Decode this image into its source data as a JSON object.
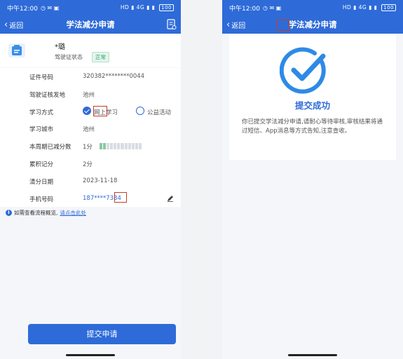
{
  "status_bar": {
    "left": {
      "time": "中午12:00",
      "icons": "◷ ✉ ▣"
    },
    "right_icons": "HD ▮ 4G ▮ ▮",
    "battery": "100"
  },
  "left_screen": {
    "nav": {
      "back_label": "返回",
      "title": "学法减分申请"
    },
    "profile": {
      "name": "*璐",
      "license_status_label": "驾驶证状态",
      "license_status_value": "正常"
    },
    "form": {
      "id_number": {
        "label": "证件号码",
        "value": "320382********0044"
      },
      "issue_place": {
        "label": "驾驶证核发地",
        "value": "池州"
      },
      "study_mode": {
        "label": "学习方式",
        "option_online": "网上学习",
        "option_public": "公益活动",
        "selected": "网上学习"
      },
      "study_city": {
        "label": "学习城市",
        "value": "池州"
      },
      "weekly_reduced": {
        "label": "本周期已减分数",
        "value": "1分",
        "segments_total": 12,
        "segments_filled": 2
      },
      "accumulated": {
        "label": "累积记分",
        "value": "2分"
      },
      "clear_date": {
        "label": "清分日期",
        "value": "2023-11-18"
      },
      "phone": {
        "label": "手机号码",
        "value": "187****7384"
      }
    },
    "info": {
      "text": "如需查看流程概览,",
      "link": "请点击此处"
    },
    "submit_label": "提交申请"
  },
  "right_screen": {
    "nav": {
      "back_label": "返回",
      "title": "学法减分申请"
    },
    "success_title": "提交成功",
    "success_message": "你已提交学法减分申请,请耐心等待审核,审核结果将通过短信、App消息等方式告知,注意查收。"
  },
  "colors": {
    "primary": "#2e6bd8",
    "highlight": "#c83a2a",
    "status_green": "#2a9d6a"
  }
}
